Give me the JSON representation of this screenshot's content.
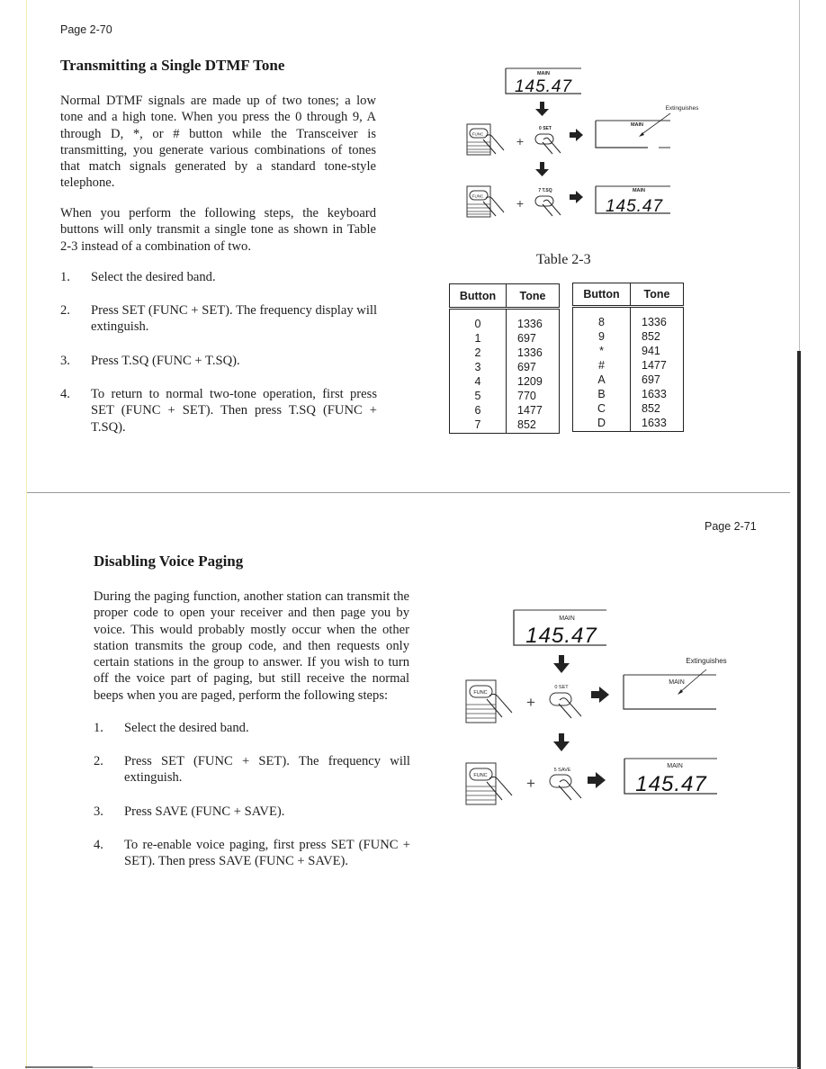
{
  "page_left": {
    "page_number": "Page 2-70",
    "heading": "Transmitting a Single DTMF Tone",
    "intro": "Normal DTMF signals are made up of two tones; a low tone and a high tone. When you press the 0 through 9, A through D, *, or # button while the Transceiver is transmitting, you generate various combinations of tones that match signals generated by a standard tone-style telephone.",
    "intro2": "When you perform the following steps, the keyboard buttons will only transmit a single tone as shown in Table 2-3 instead of a combination of two.",
    "steps": [
      {
        "num": "1.",
        "text": "Select the desired band."
      },
      {
        "num": "2.",
        "text": "Press SET (FUNC + SET). The frequency display will extinguish."
      },
      {
        "num": "3.",
        "text": "Press T.SQ (FUNC + T.SQ)."
      },
      {
        "num": "4.",
        "text": "To return to normal two-tone operation, first press SET (FUNC + SET). Then press T.SQ (FUNC + T.SQ)."
      }
    ],
    "diagram": {
      "display_label": "MAIN",
      "frequency": "145.47",
      "func_key": "FUNC",
      "set_key": "0 SET",
      "second_key": "7 T.SQ",
      "annotation": "Extinguishes"
    },
    "table": {
      "caption": "Table 2-3",
      "headers": [
        "Button",
        "Tone"
      ],
      "left": {
        "buttons": [
          "0",
          "1",
          "2",
          "3",
          "4",
          "5",
          "6",
          "7"
        ],
        "tones": [
          "1336",
          "697",
          "1336",
          "697",
          "1209",
          "770",
          "1477",
          "852"
        ]
      },
      "right": {
        "buttons": [
          "8",
          "9",
          "*",
          "#",
          "A",
          "B",
          "C",
          "D"
        ],
        "tones": [
          "1336",
          "852",
          "941",
          "1477",
          "697",
          "1633",
          "852",
          "1633"
        ]
      }
    }
  },
  "page_right": {
    "page_number": "Page 2-71",
    "heading": "Disabling Voice Paging",
    "intro": "During the paging function, another station can transmit the proper code to open your receiver and then page you by voice. This would probably mostly occur when the other station transmits the group code, and then requests only certain stations in the group to answer. If you wish to turn off the voice part of paging, but still receive the normal beeps when you are paged, perform the following steps:",
    "steps": [
      {
        "num": "1.",
        "text": "Select the desired band."
      },
      {
        "num": "2.",
        "text": "Press SET (FUNC + SET). The frequency will extinguish."
      },
      {
        "num": "3.",
        "text": "Press SAVE (FUNC + SAVE)."
      },
      {
        "num": "4.",
        "text": "To re-enable voice paging, first press SET (FUNC + SET). Then press SAVE (FUNC + SAVE)."
      }
    ],
    "diagram": {
      "display_label": "MAIN",
      "frequency": "145.47",
      "func_key": "FUNC",
      "set_key": "0 SET",
      "second_key": "5 SAVE",
      "annotation": "Extinguishes"
    }
  }
}
